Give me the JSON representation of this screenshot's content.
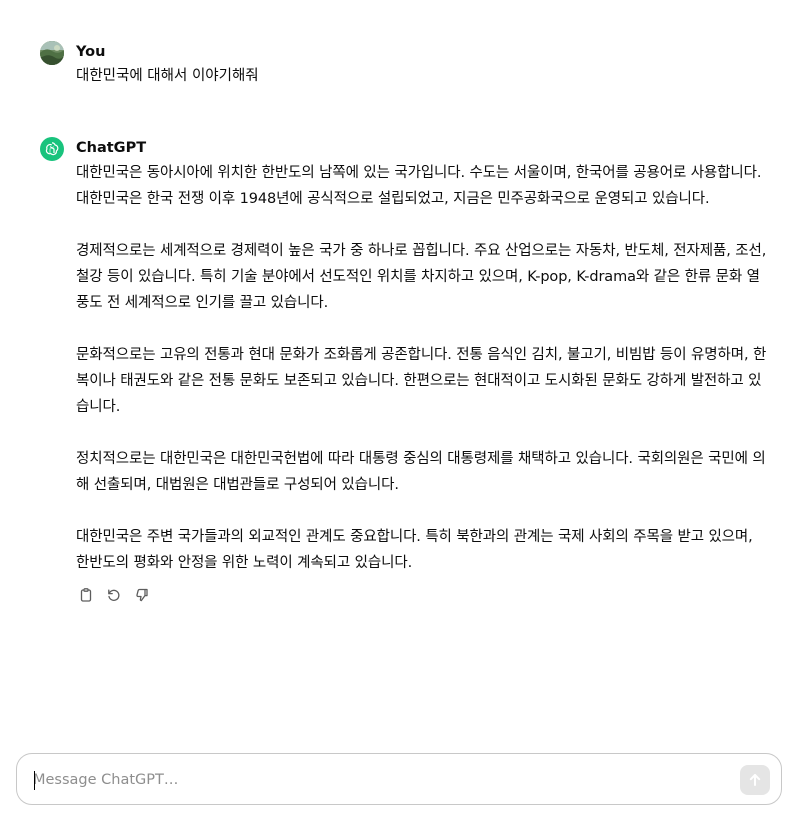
{
  "user_turn": {
    "author": "You",
    "avatar_icon": "user-avatar",
    "message": "대한민국에 대해서 이야기해줘"
  },
  "assistant_turn": {
    "author": "ChatGPT",
    "avatar_icon": "openai-logo-icon",
    "avatar_color": "#19c37d",
    "paragraphs": [
      "대한민국은 동아시아에 위치한 한반도의 남쪽에 있는 국가입니다. 수도는 서울이며, 한국어를 공용어로 사용합니다. 대한민국은 한국 전쟁 이후 1948년에 공식적으로 설립되었고, 지금은 민주공화국으로 운영되고 있습니다.",
      "경제적으로는 세계적으로 경제력이 높은 국가 중 하나로 꼽힙니다. 주요 산업으로는 자동차, 반도체, 전자제품, 조선, 철강 등이 있습니다. 특히 기술 분야에서 선도적인 위치를 차지하고 있으며, K-pop, K-drama와 같은 한류 문화 열풍도 전 세계적으로 인기를 끌고 있습니다.",
      "문화적으로는 고유의 전통과 현대 문화가 조화롭게 공존합니다. 전통 음식인 김치, 불고기, 비빔밥 등이 유명하며, 한복이나 태권도와 같은 전통 문화도 보존되고 있습니다. 한편으로는 현대적이고 도시화된 문화도 강하게 발전하고 있습니다.",
      "정치적으로는 대한민국은 대한민국헌법에 따라 대통령 중심의 대통령제를 채택하고 있습니다. 국회의원은 국민에 의해 선출되며, 대법원은 대법관들로 구성되어 있습니다.",
      "대한민국은 주변 국가들과의 외교적인 관계도 중요합니다. 특히 북한과의 관계는 국제 사회의 주목을 받고 있으며, 한반도의 평화와 안정을 위한 노력이 계속되고 있습니다."
    ],
    "action_icons": [
      "clipboard-icon",
      "regenerate-icon",
      "thumbs-down-icon"
    ]
  },
  "composer": {
    "placeholder": "Message ChatGPT…",
    "value": "",
    "send_icon": "arrow-up-icon"
  }
}
